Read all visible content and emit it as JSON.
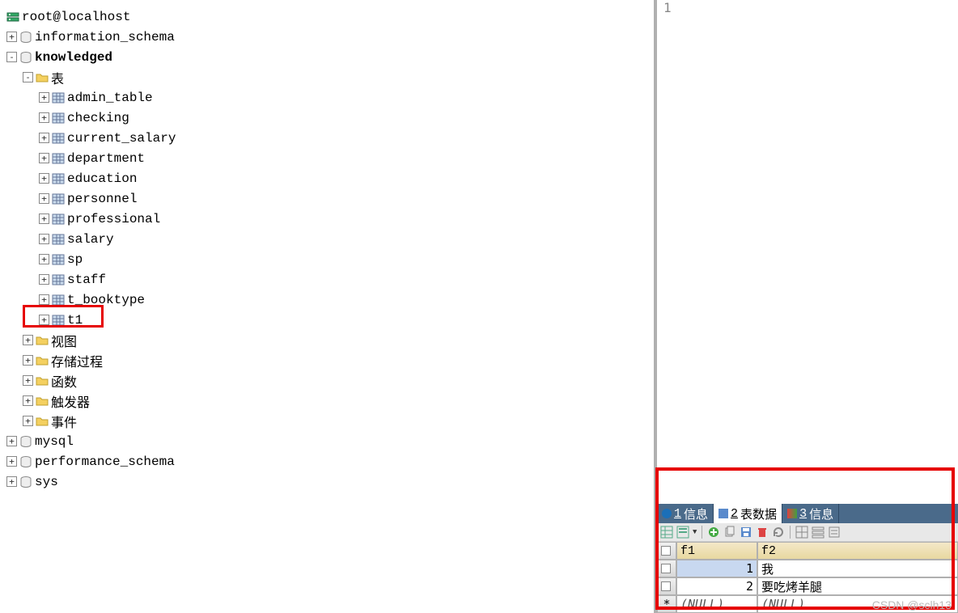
{
  "tree": {
    "root": {
      "label": "root@localhost",
      "type": "server"
    },
    "info_schema": {
      "label": "information_schema",
      "type": "db"
    },
    "knowledged": {
      "label": "knowledged",
      "type": "db"
    },
    "tables_folder": {
      "label": "表"
    },
    "tables": [
      {
        "label": "admin_table"
      },
      {
        "label": "checking"
      },
      {
        "label": "current_salary"
      },
      {
        "label": "department"
      },
      {
        "label": "education"
      },
      {
        "label": "personnel"
      },
      {
        "label": "professional"
      },
      {
        "label": "salary"
      },
      {
        "label": "sp"
      },
      {
        "label": "staff"
      },
      {
        "label": "t_booktype"
      },
      {
        "label": "t1"
      }
    ],
    "folders": [
      {
        "label": "视图"
      },
      {
        "label": "存储过程"
      },
      {
        "label": "函数"
      },
      {
        "label": "触发器"
      },
      {
        "label": "事件"
      }
    ],
    "other_dbs": [
      {
        "label": "mysql"
      },
      {
        "label": "performance_schema"
      },
      {
        "label": "sys"
      }
    ]
  },
  "editor": {
    "line1": "1"
  },
  "tabs": {
    "t1": {
      "num": "1",
      "label": "信息"
    },
    "t2": {
      "num": "2",
      "label": "表数据"
    },
    "t3": {
      "num": "3",
      "label": "信息"
    }
  },
  "grid": {
    "columns": [
      "f1",
      "f2"
    ],
    "rows": [
      {
        "f1": "1",
        "f2": "我"
      },
      {
        "f1": "2",
        "f2": "要吃烤羊腿"
      }
    ],
    "null_label": "(NULL)",
    "new_row_marker": "*"
  },
  "watermark": "CSDN @sclh13"
}
